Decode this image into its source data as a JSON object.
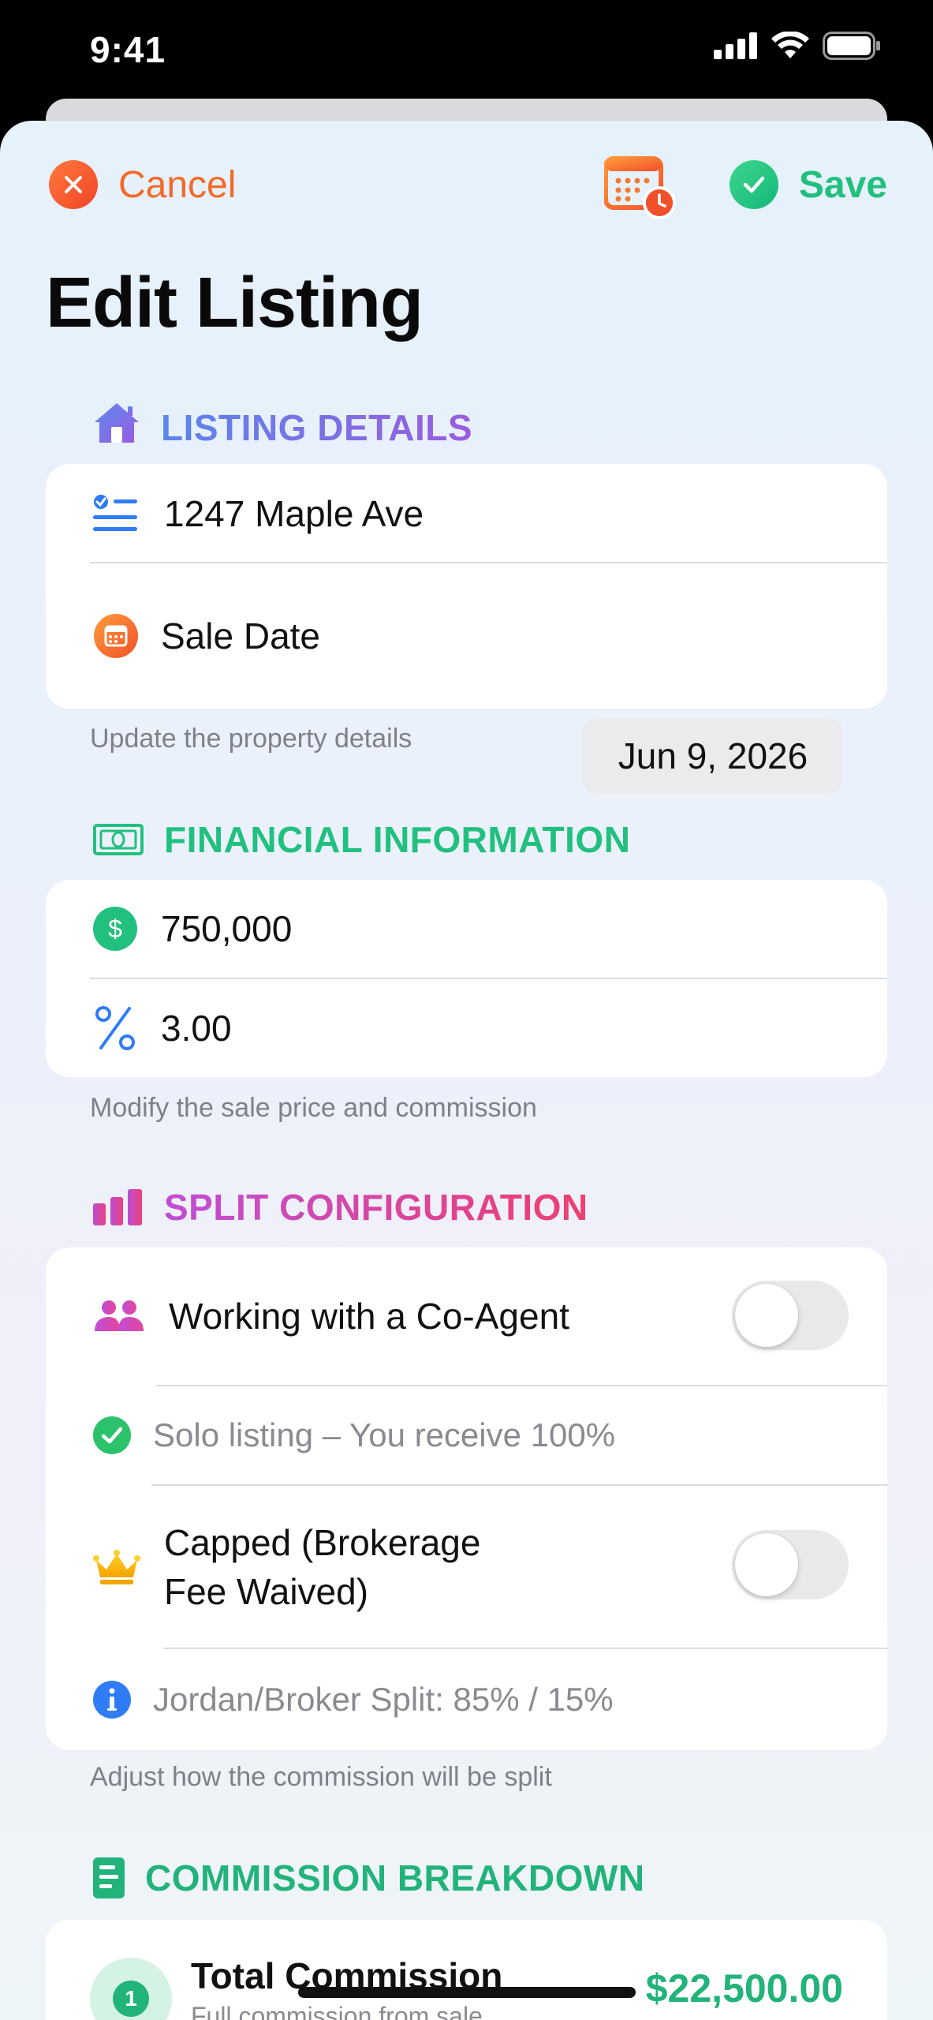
{
  "status_bar": {
    "time": "9:41"
  },
  "nav": {
    "cancel_label": "Cancel",
    "save_label": "Save"
  },
  "page": {
    "title": "Edit Listing"
  },
  "listing_details": {
    "header": "LISTING DETAILS",
    "address": "1247 Maple Ave",
    "sale_date_label": "Sale Date",
    "sale_date_value": "Jun 9, 2026",
    "footer": "Update the property details"
  },
  "financial": {
    "header": "FINANCIAL INFORMATION",
    "price": "750,000",
    "commission_rate": "3.00",
    "footer": "Modify the sale price and commission"
  },
  "split": {
    "header": "SPLIT CONFIGURATION",
    "co_agent_label": "Working with a Co-Agent",
    "co_agent_enabled": false,
    "solo_info": "Solo listing – You receive 100%",
    "capped_label_line1": "Capped (Brokerage",
    "capped_label_line2": "Fee Waived)",
    "capped_enabled": false,
    "split_info": "Jordan/Broker Split: 85% / 15%",
    "footer": "Adjust how the commission will be split"
  },
  "breakdown": {
    "header": "COMMISSION BREAKDOWN",
    "step_number": "1",
    "total_label": "Total Commission",
    "total_sublabel": "Full commission from sale",
    "total_value": "$22,500.00"
  },
  "colors": {
    "listing_header": "#8a63e0",
    "financial_header": "#22c07e",
    "split_header": "#e0429e",
    "breakdown_header": "#22b37a",
    "cancel": "#f26a2a",
    "save": "#22c07e"
  }
}
